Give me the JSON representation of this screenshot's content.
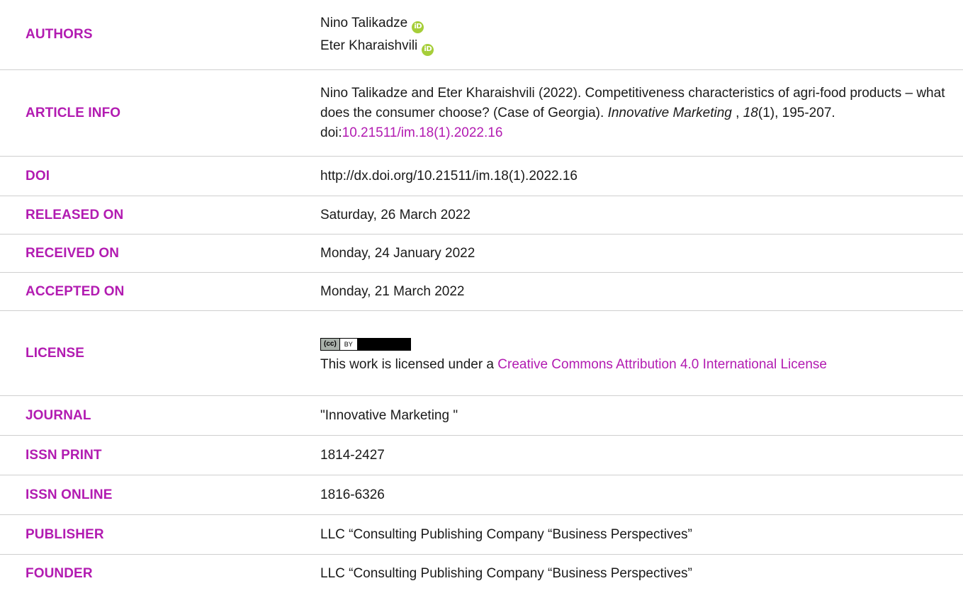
{
  "authors": {
    "label": "AUTHORS",
    "names": [
      "Nino Talikadze",
      "Eter Kharaishvili"
    ]
  },
  "article_info": {
    "label": "ARTICLE INFO",
    "citation_text": "Nino Talikadze and Eter Kharaishvili (2022). Competitiveness characteristics of agri-food products – what does the consumer choose? (Case of Georgia).",
    "journal_name": "Innovative Marketing",
    "sep": " , ",
    "volume": "18",
    "issue_pages": "(1), 195-207. doi:",
    "doi_link": "10.21511/im.18(1).2022.16"
  },
  "doi": {
    "label": "DOI",
    "value": "http://dx.doi.org/10.21511/im.18(1).2022.16"
  },
  "released": {
    "label": "RELEASED ON",
    "value": "Saturday, 26 March 2022"
  },
  "received": {
    "label": "RECEIVED ON",
    "value": "Monday, 24 January 2022"
  },
  "accepted": {
    "label": "ACCEPTED ON",
    "value": "Monday, 21 March 2022"
  },
  "license": {
    "label": "LICENSE",
    "badge_left": "(cc)",
    "badge_mid": "BY",
    "text": "This work is licensed under a ",
    "link": "Creative Commons Attribution 4.0 International License"
  },
  "journal": {
    "label": "JOURNAL",
    "value": "\"Innovative Marketing \""
  },
  "issn_print": {
    "label": "ISSN PRINT",
    "value": "1814-2427"
  },
  "issn_online": {
    "label": "ISSN ONLINE",
    "value": "1816-6326"
  },
  "publisher": {
    "label": "PUBLISHER",
    "value": "LLC “Consulting Publishing Company “Business Perspectives”"
  },
  "founder": {
    "label": "FOUNDER",
    "value": "LLC “Consulting Publishing Company “Business Perspectives”"
  },
  "icons": {
    "orcid": "orcid-icon",
    "orcid_glyph": "iD",
    "cc": "cc-by-badge-icon"
  },
  "colors": {
    "accent": "#b21bb1",
    "orcid": "#a6ce39",
    "rule": "#cfcfcf"
  }
}
